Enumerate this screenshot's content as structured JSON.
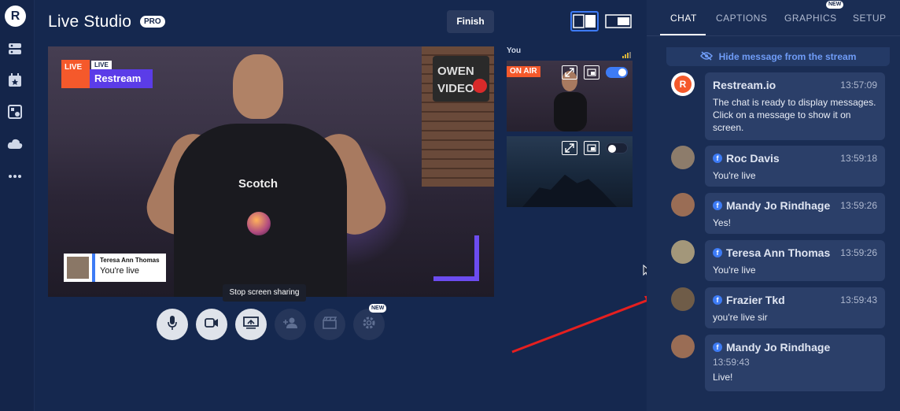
{
  "rail": {
    "logo": "R",
    "icons": [
      "channels-icon",
      "star-calendar-icon",
      "scenes-icon",
      "cloud-icon",
      "more-icon"
    ]
  },
  "studio": {
    "title": "Live Studio",
    "pro_badge": "PRO",
    "finish_label": "Finish",
    "overlay": {
      "live_tag": "LIVE",
      "live_pill": "LIVE",
      "brand": "Restream"
    },
    "video": {
      "shirt_text": "Scotch",
      "lower_third_name": "Teresa Ann Thomas",
      "lower_third_message": "You're live"
    },
    "previews": {
      "label": "You",
      "on_air": "ON AIR",
      "p1_toggle_on": true,
      "p2_toggle_on": false
    },
    "tooltip": "Stop screen sharing",
    "controls_new_badge": "NEW"
  },
  "chat": {
    "tabs": [
      "CHAT",
      "CAPTIONS",
      "GRAPHICS",
      "SETUP"
    ],
    "graphics_new_badge": "NEW",
    "hide_message": "Hide message from the stream",
    "messages": [
      {
        "author": "Restream.io",
        "time": "13:57:09",
        "text": "The chat is ready to display messages. Click on a message to show it on screen."
      },
      {
        "author": "Roc Davis",
        "time": "13:59:18",
        "text": "You're live"
      },
      {
        "author": "Mandy Jo Rindhage",
        "time": "13:59:26",
        "text": "Yes!"
      },
      {
        "author": "Teresa Ann Thomas",
        "time": "13:59:26",
        "text": "You're live"
      },
      {
        "author": "Frazier Tkd",
        "time": "13:59:43",
        "text": "you're live sir"
      },
      {
        "author": "Mandy Jo Rindhage",
        "time": "13:59:43",
        "text": "Live!"
      }
    ]
  },
  "colors": {
    "accent_blue": "#3d7bf5",
    "restream_orange": "#f5592b",
    "restream_purple": "#5b3ce8",
    "panel_bg": "#1a2d54"
  }
}
